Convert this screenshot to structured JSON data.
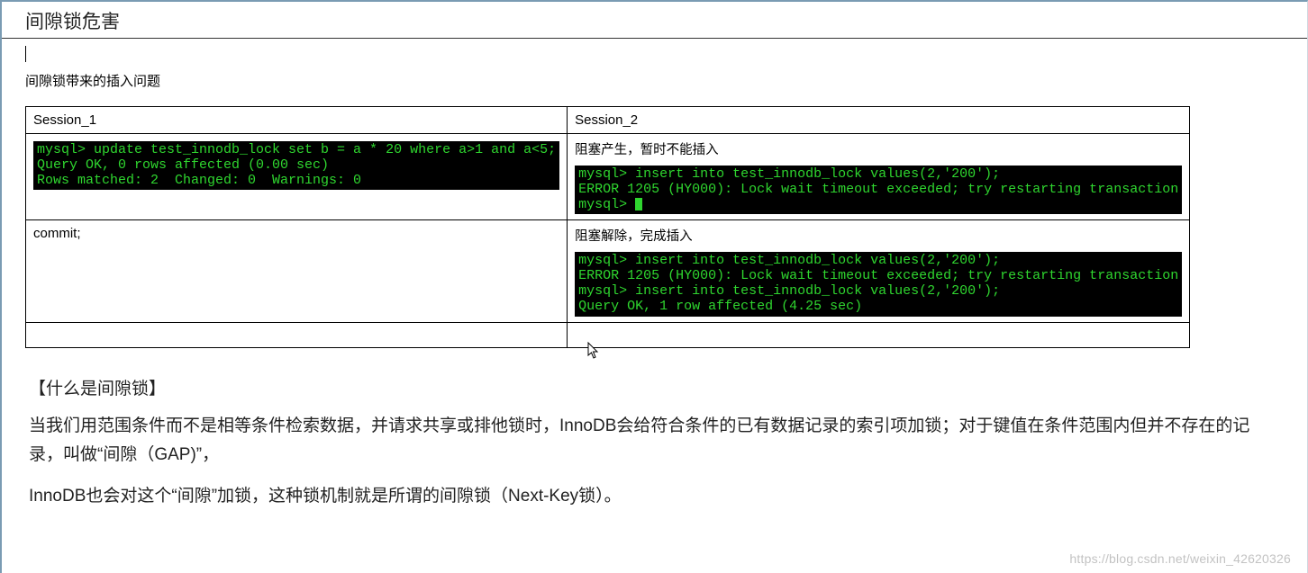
{
  "title": "间隙锁危害",
  "subtitle": "间隙锁带来的插入问题",
  "table": {
    "headers": [
      "Session_1",
      "Session_2"
    ],
    "rows": [
      {
        "left_term": "mysql> update test_innodb_lock set b = a * 20 where a>1 and a<5;\nQuery OK, 0 rows affected (0.00 sec)\nRows matched: 2  Changed: 0  Warnings: 0",
        "right_note": "阻塞产生，暂时不能插入",
        "right_term": "mysql> insert into test_innodb_lock values(2,'200');\nERROR 1205 (HY000): Lock wait timeout exceeded; try restarting transaction\nmysql> ",
        "right_has_cursor": true
      },
      {
        "left_plain": "commit;",
        "right_note": "阻塞解除，完成插入",
        "right_term": "mysql> insert into test_innodb_lock values(2,'200');\nERROR 1205 (HY000): Lock wait timeout exceeded; try restarting transaction\nmysql> insert into test_innodb_lock values(2,'200');\nQuery OK, 1 row affected (4.25 sec)"
      }
    ]
  },
  "section_heading": "【什么是间隙锁】",
  "paragraph1": "当我们用范围条件而不是相等条件检索数据，并请求共享或排他锁时，InnoDB会给符合条件的已有数据记录的索引项加锁；对于键值在条件范围内但并不存在的记录，叫做“间隙（GAP)”，",
  "paragraph2": "InnoDB也会对这个“间隙”加锁，这种锁机制就是所谓的间隙锁（Next-Key锁）。",
  "watermark": "https://blog.csdn.net/weixin_42620326"
}
